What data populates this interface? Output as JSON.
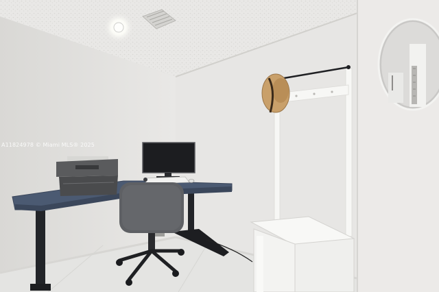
{
  "watermark": {
    "text": "A11824978 © Miami MLS® 2025"
  },
  "palette": {
    "ceiling": "#ecebea",
    "wall_left": "#ebeae8",
    "wall_center": "#e7e6e4",
    "wall_right": "#edecea",
    "floor": "#e9e9e7",
    "desk_top": "#4b5a72",
    "desk_frame": "#222428",
    "chair": "#5e6064",
    "printer": "#4a4b4d",
    "monitor": "#1c1d20",
    "hat": "#c9a06a",
    "hallstand": "#f6f6f4"
  }
}
